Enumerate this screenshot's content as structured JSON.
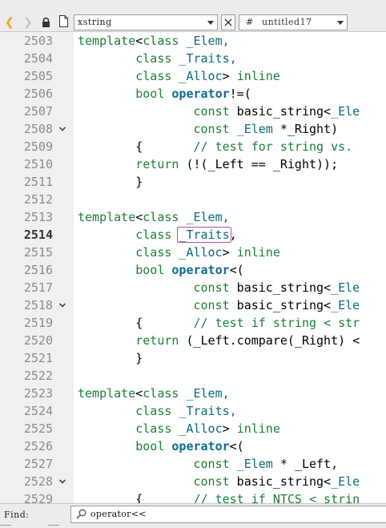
{
  "toolbar": {
    "back_icon": "chevron-left-icon",
    "forward_icon": "chevron-right-icon",
    "file_name": "xstring",
    "symbol_hash": "#",
    "symbol_name": "untitled17"
  },
  "editor": {
    "current_line": "2514",
    "lines": [
      {
        "n": "2503",
        "segs": [
          [
            "template",
            "kw"
          ],
          [
            "<",
            ""
          ],
          [
            "class",
            "kw"
          ],
          [
            " _Elem,",
            "ty"
          ]
        ]
      },
      {
        "n": "2504",
        "segs": [
          [
            "        ",
            ""
          ],
          [
            "class",
            "kw"
          ],
          [
            " _Traits,",
            "ty"
          ]
        ]
      },
      {
        "n": "2505",
        "segs": [
          [
            "        ",
            ""
          ],
          [
            "class",
            "kw"
          ],
          [
            " _Alloc",
            "ty"
          ],
          [
            "> ",
            ""
          ],
          [
            "inline",
            "kw"
          ]
        ]
      },
      {
        "n": "2506",
        "segs": [
          [
            "        ",
            ""
          ],
          [
            "bool",
            "kw"
          ],
          [
            " ",
            ""
          ],
          [
            "operator",
            "op"
          ],
          [
            "!=(",
            ""
          ]
        ]
      },
      {
        "n": "2507",
        "segs": [
          [
            "                ",
            ""
          ],
          [
            "const",
            "kw"
          ],
          [
            " basic_string<",
            ""
          ],
          [
            "_Ele",
            "ty"
          ]
        ]
      },
      {
        "n": "2508",
        "fold": true,
        "segs": [
          [
            "                ",
            ""
          ],
          [
            "const",
            "kw"
          ],
          [
            " _Elem",
            "ty"
          ],
          [
            " *_Right)",
            ""
          ]
        ]
      },
      {
        "n": "2509",
        "segs": [
          [
            "        {       ",
            ""
          ],
          [
            "// test for string vs.",
            "cm"
          ]
        ]
      },
      {
        "n": "2510",
        "segs": [
          [
            "        ",
            ""
          ],
          [
            "return",
            "kw"
          ],
          [
            " (!(_Left == _Right));",
            ""
          ]
        ]
      },
      {
        "n": "2511",
        "segs": [
          [
            "        }",
            ""
          ]
        ]
      },
      {
        "n": "2512",
        "segs": []
      },
      {
        "n": "2513",
        "segs": [
          [
            "template",
            "kw"
          ],
          [
            "<",
            ""
          ],
          [
            "class",
            "kw"
          ],
          [
            " _Elem,",
            "ty"
          ]
        ]
      },
      {
        "n": "2514",
        "segs": [
          [
            "        ",
            ""
          ],
          [
            "class",
            "kw"
          ],
          [
            " ",
            ""
          ],
          [
            "_Traits",
            "ty hl"
          ],
          [
            ",",
            ""
          ]
        ]
      },
      {
        "n": "2515",
        "segs": [
          [
            "        ",
            ""
          ],
          [
            "class",
            "kw"
          ],
          [
            " _Alloc",
            "ty"
          ],
          [
            "> ",
            ""
          ],
          [
            "inline",
            "kw"
          ]
        ]
      },
      {
        "n": "2516",
        "segs": [
          [
            "        ",
            ""
          ],
          [
            "bool",
            "kw"
          ],
          [
            " ",
            ""
          ],
          [
            "operator",
            "op"
          ],
          [
            "<(",
            ""
          ]
        ]
      },
      {
        "n": "2517",
        "segs": [
          [
            "                ",
            ""
          ],
          [
            "const",
            "kw"
          ],
          [
            " basic_string<",
            ""
          ],
          [
            "_Ele",
            "ty"
          ]
        ]
      },
      {
        "n": "2518",
        "fold": true,
        "segs": [
          [
            "                ",
            ""
          ],
          [
            "const",
            "kw"
          ],
          [
            " basic_string<",
            ""
          ],
          [
            "_Ele",
            "ty"
          ]
        ]
      },
      {
        "n": "2519",
        "segs": [
          [
            "        {       ",
            ""
          ],
          [
            "// test if string < str",
            "cm"
          ]
        ]
      },
      {
        "n": "2520",
        "segs": [
          [
            "        ",
            ""
          ],
          [
            "return",
            "kw"
          ],
          [
            " (_Left.compare(_Right) <",
            ""
          ]
        ]
      },
      {
        "n": "2521",
        "segs": [
          [
            "        }",
            ""
          ]
        ]
      },
      {
        "n": "2522",
        "segs": []
      },
      {
        "n": "2523",
        "segs": [
          [
            "template",
            "kw"
          ],
          [
            "<",
            ""
          ],
          [
            "class",
            "kw"
          ],
          [
            " _Elem,",
            "ty"
          ]
        ]
      },
      {
        "n": "2524",
        "segs": [
          [
            "        ",
            ""
          ],
          [
            "class",
            "kw"
          ],
          [
            " _Traits,",
            "ty"
          ]
        ]
      },
      {
        "n": "2525",
        "segs": [
          [
            "        ",
            ""
          ],
          [
            "class",
            "kw"
          ],
          [
            " _Alloc",
            "ty"
          ],
          [
            "> ",
            ""
          ],
          [
            "inline",
            "kw"
          ]
        ]
      },
      {
        "n": "2526",
        "segs": [
          [
            "        ",
            ""
          ],
          [
            "bool",
            "kw"
          ],
          [
            " ",
            ""
          ],
          [
            "operator",
            "op"
          ],
          [
            "<(",
            ""
          ]
        ]
      },
      {
        "n": "2527",
        "segs": [
          [
            "                ",
            ""
          ],
          [
            "const",
            "kw"
          ],
          [
            " _Elem",
            "ty"
          ],
          [
            " * _Left,",
            ""
          ]
        ]
      },
      {
        "n": "2528",
        "fold": true,
        "segs": [
          [
            "                ",
            ""
          ],
          [
            "const",
            "kw"
          ],
          [
            " basic_string<",
            ""
          ],
          [
            "_Ele",
            "ty"
          ]
        ]
      },
      {
        "n": "2529",
        "segs": [
          [
            "        {       ",
            ""
          ],
          [
            "// test if NTCS < strin",
            "cm"
          ]
        ]
      }
    ]
  },
  "find": {
    "label": "Find:",
    "icon": "magnifier-icon",
    "value": "operator<<"
  },
  "colors": {
    "keyword": "#1a7f37",
    "type": "#0c6a7a",
    "operator": "#0b6b8e",
    "back_arrow": "#f0a500",
    "highlight_border": "#b04cc0"
  }
}
